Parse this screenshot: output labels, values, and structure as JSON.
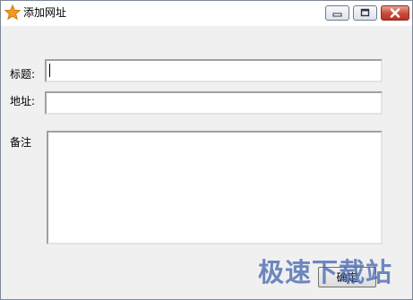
{
  "window": {
    "title": "添加网址",
    "icon": "star-icon"
  },
  "form": {
    "title_label": "标题:",
    "title_value": "",
    "url_label": "地址:",
    "url_value": "",
    "note_label": "备注",
    "note_value": ""
  },
  "actions": {
    "ok_label": "确定"
  },
  "watermark": {
    "text": "极速下载站"
  },
  "colors": {
    "star": "#f39a1e",
    "close_button": "#c9493a",
    "window_body": "#f0f0f0"
  }
}
